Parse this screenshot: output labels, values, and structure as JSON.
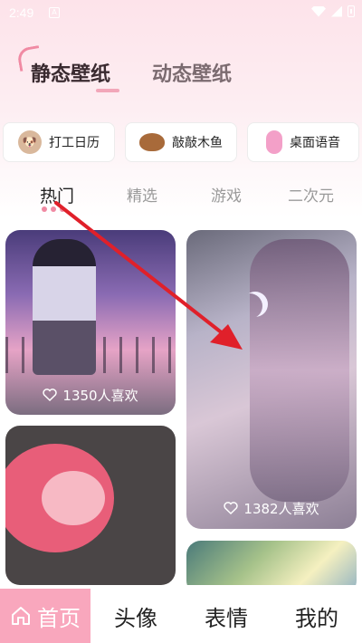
{
  "status_bar": {
    "time": "2:49",
    "app_badge": "A"
  },
  "top_tabs": {
    "active": "静态壁纸",
    "inactive": "动态壁纸"
  },
  "shortcuts": [
    {
      "label": "打工日历",
      "icon": "dog-icon"
    },
    {
      "label": "敲敲木鱼",
      "icon": "wooden-fish-icon"
    },
    {
      "label": "桌面语音",
      "icon": "microphone-icon"
    }
  ],
  "categories": [
    "热门",
    "精选",
    "游戏",
    "二次元"
  ],
  "cards": [
    {
      "likes": "1350人喜欢"
    },
    {
      "likes": "1382人喜欢"
    }
  ],
  "bottom_nav": [
    "首页",
    "头像",
    "表情",
    "我的"
  ],
  "colors": {
    "accent": "#f9a7bd",
    "arrow": "#e0202a"
  }
}
